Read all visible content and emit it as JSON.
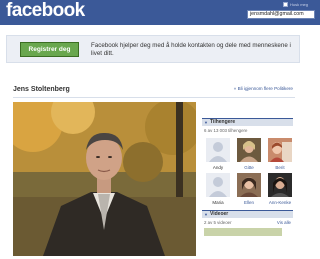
{
  "header": {
    "logo": "facebook",
    "keep_logged_in_label": "Husk meg",
    "email_value": "jensmdahl@gmail.com"
  },
  "banner": {
    "register_label": "Registrer deg",
    "text": "Facebook hjelper deg med å holde kontakten og dele med menneskene i livet ditt."
  },
  "profile": {
    "name": "Jens Stoltenberg",
    "find_link": "« Bli igjennom flere Politikere"
  },
  "sidebar": {
    "fans_title": "Tilhengere",
    "fans_count": "6 av 13 003 tilhengere",
    "fans": [
      {
        "name": "Andy",
        "has_photo": false
      },
      {
        "name": "Gitte",
        "has_photo": true
      },
      {
        "name": "Berit",
        "has_photo": true
      },
      {
        "name": "Maria",
        "has_photo": false
      },
      {
        "name": "Ellen",
        "has_photo": true
      },
      {
        "name": "Ann-Kenke",
        "has_photo": true
      }
    ],
    "videos_title": "Videoer",
    "videos_count": "2 av 5 videoer",
    "videos_link": "Vis alle"
  },
  "colors": {
    "brand_blue": "#3b5998",
    "register_green": "#69a74e",
    "banner_bg": "#eceff5",
    "section_header_bg": "#d8dfea"
  }
}
